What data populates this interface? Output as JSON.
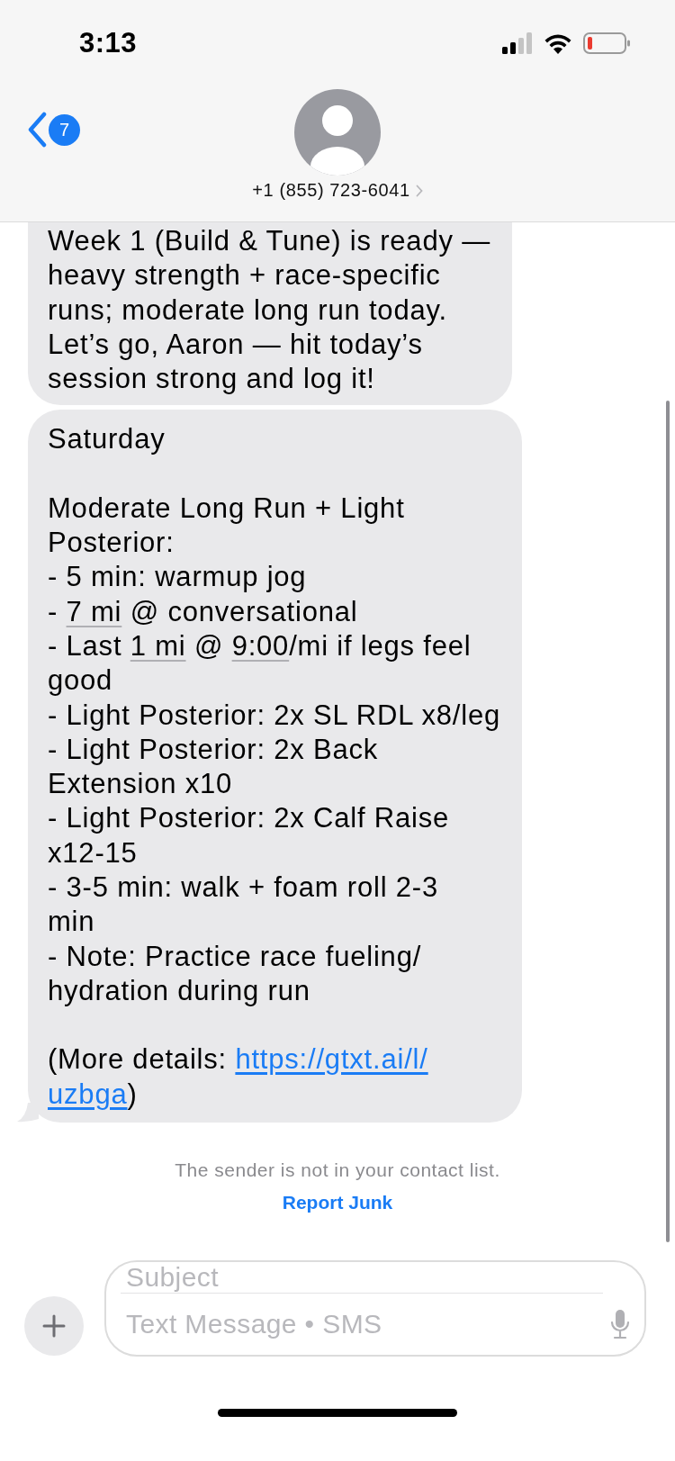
{
  "status_bar": {
    "time": "3:13"
  },
  "header": {
    "back_badge": "7",
    "contact": "+1 (855) 723-6041"
  },
  "messages": [
    {
      "tail": false,
      "paragraphs": [
        [
          [
            {
              "kind": "text",
              "text": "Week 1 (Build & Tune) is ready —"
            }
          ],
          [
            {
              "kind": "text",
              "text": "heavy strength + race-specific"
            }
          ],
          [
            {
              "kind": "text",
              "text": "runs; moderate long run today."
            }
          ],
          [
            {
              "kind": "text",
              "text": "Let’s go, Aaron — hit today’s"
            }
          ],
          [
            {
              "kind": "text",
              "text": "session strong and log it!"
            }
          ]
        ]
      ]
    },
    {
      "tail": true,
      "paragraphs": [
        [
          [
            {
              "kind": "text",
              "text": "Saturday"
            }
          ]
        ],
        [
          [
            {
              "kind": "text",
              "text": "Moderate Long Run + Light"
            }
          ],
          [
            {
              "kind": "text",
              "text": "Posterior:"
            }
          ],
          [
            {
              "kind": "text",
              "text": "- 5 min: warmup jog"
            }
          ],
          [
            {
              "kind": "text",
              "text": "- "
            },
            {
              "kind": "detected",
              "text": "7 mi"
            },
            {
              "kind": "text",
              "text": " @ conversational"
            }
          ],
          [
            {
              "kind": "text",
              "text": "- Last "
            },
            {
              "kind": "detected",
              "text": "1 mi"
            },
            {
              "kind": "text",
              "text": " @ "
            },
            {
              "kind": "detected",
              "text": "9:00"
            },
            {
              "kind": "text",
              "text": "/mi if legs feel"
            }
          ],
          [
            {
              "kind": "text",
              "text": "good"
            }
          ],
          [
            {
              "kind": "text",
              "text": "- Light Posterior: 2x SL RDL x8/leg"
            }
          ],
          [
            {
              "kind": "text",
              "text": "- Light Posterior: 2x Back"
            }
          ],
          [
            {
              "kind": "text",
              "text": "Extension x10"
            }
          ],
          [
            {
              "kind": "text",
              "text": "- Light Posterior: 2x Calf Raise"
            }
          ],
          [
            {
              "kind": "text",
              "text": "x12-15"
            }
          ],
          [
            {
              "kind": "text",
              "text": "- 3-5 min: walk + foam roll 2-3"
            }
          ],
          [
            {
              "kind": "text",
              "text": "min"
            }
          ],
          [
            {
              "kind": "text",
              "text": "- Note: Practice race fueling/"
            }
          ],
          [
            {
              "kind": "text",
              "text": "hydration during run"
            }
          ]
        ],
        [
          [
            {
              "kind": "text",
              "text": "(More details: "
            },
            {
              "kind": "link",
              "text": "https://gtxt.ai/l/"
            }
          ],
          [
            {
              "kind": "link",
              "text": "uzbga"
            },
            {
              "kind": "text",
              "text": ")"
            }
          ]
        ]
      ]
    }
  ],
  "notice": "The sender is not in your contact list.",
  "report_link": "Report Junk",
  "composer": {
    "subject_placeholder": "Subject",
    "message_placeholder": "Text Message • SMS"
  }
}
